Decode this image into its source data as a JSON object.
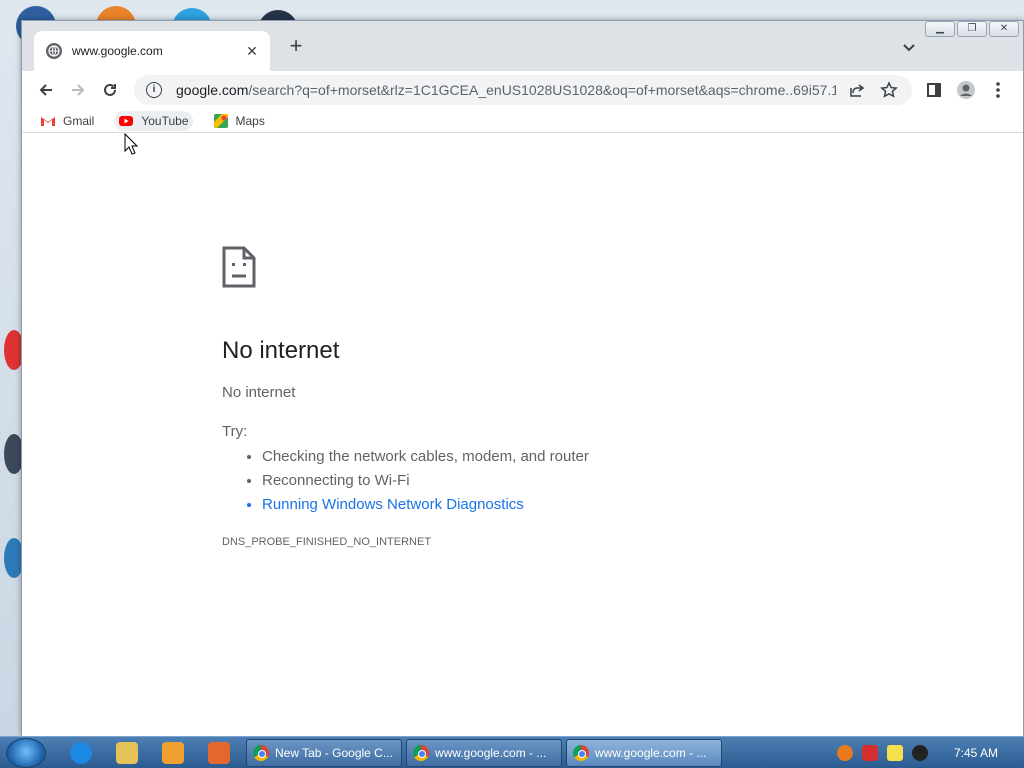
{
  "browser": {
    "tab": {
      "title": "www.google.com",
      "favicon": "globe-icon"
    },
    "url": {
      "host": "google.com",
      "rest": "/search?q=of+morset&rlz=1C1GCEA_enUS1028US1028&oq=of+morset&aqs=chrome..69i57.12..."
    },
    "bookmarks": [
      {
        "label": "Gmail",
        "icon": "gmail-icon"
      },
      {
        "label": "YouTube",
        "icon": "youtube-icon"
      },
      {
        "label": "Maps",
        "icon": "maps-icon"
      }
    ]
  },
  "error": {
    "title": "No internet",
    "subtitle": "No internet",
    "try_label": "Try:",
    "suggestions": [
      "Checking the network cables, modem, and router",
      "Reconnecting to Wi-Fi",
      "Running Windows Network Diagnostics"
    ],
    "code": "DNS_PROBE_FINISHED_NO_INTERNET"
  },
  "taskbar": {
    "items": [
      {
        "label": "New Tab - Google C..."
      },
      {
        "label": "www.google.com - ..."
      },
      {
        "label": "www.google.com - ..."
      }
    ],
    "clock": "7:45 AM"
  },
  "colors": {
    "link": "#1a73e8",
    "text": "#202124",
    "muted": "#5f6368"
  }
}
